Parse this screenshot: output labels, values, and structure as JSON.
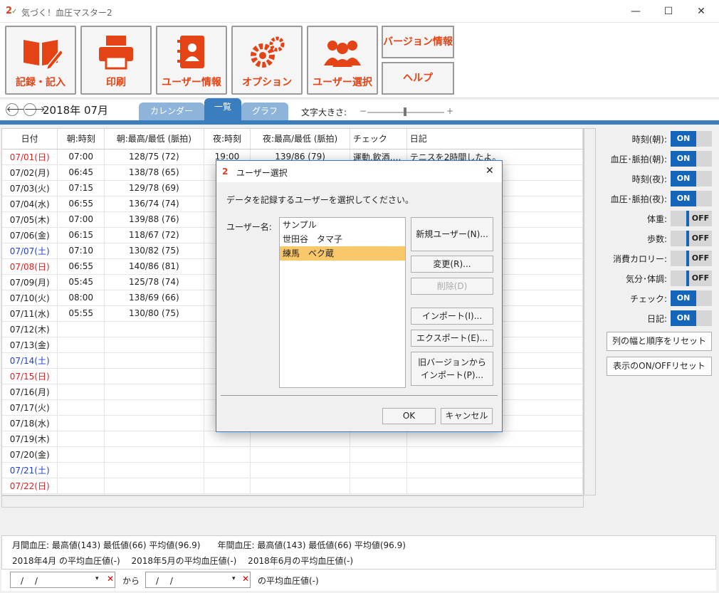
{
  "window": {
    "title": "気づく！血圧マスター2",
    "logo": "2",
    "minimize": "—",
    "maximize": "☐",
    "close": "✕"
  },
  "toolbar": {
    "buttons": [
      {
        "label": "記録・記入",
        "icon": "book-pen-icon"
      },
      {
        "label": "印刷",
        "icon": "printer-icon"
      },
      {
        "label": "ユーザー情報",
        "icon": "address-book-icon"
      },
      {
        "label": "オプション",
        "icon": "gears-icon"
      },
      {
        "label": "ユーザー選択",
        "icon": "users-icon"
      }
    ],
    "version_label": "バージョン情報",
    "help_label": "ヘルプ"
  },
  "nav": {
    "prev": "🡐",
    "next": "🡒",
    "month": "2018年 07月",
    "tabs": [
      "カレンダー",
      "一覧",
      "グラフ"
    ],
    "fontsize_label": "文字大きさ:",
    "minus": "−",
    "plus": "+"
  },
  "grid": {
    "columns": [
      "日付",
      "朝:時刻",
      "朝:最高/最低 (脈拍)",
      "夜:時刻",
      "夜:最高/最低 (脈拍)",
      "チェック",
      "日記"
    ],
    "rows": [
      {
        "d": "07/01(日)",
        "c": "red",
        "mt": "07:00",
        "mb": "128/75 (72)",
        "nt": "19:00",
        "nb": "139/86 (79)",
        "ck": "運動,飲酒,…",
        "dy": "テニスを2時間したよ。"
      },
      {
        "d": "07/02(月)",
        "c": "",
        "mt": "06:45",
        "mb": "138/78 (65)",
        "nt": "",
        "nb": "",
        "ck": "",
        "dy": ""
      },
      {
        "d": "07/03(火)",
        "c": "",
        "mt": "07:15",
        "mb": "129/78 (69)",
        "nt": "",
        "nb": "",
        "ck": "",
        "dy": ""
      },
      {
        "d": "07/04(水)",
        "c": "",
        "mt": "06:55",
        "mb": "136/74 (74)",
        "nt": "",
        "nb": "",
        "ck": "",
        "dy": ""
      },
      {
        "d": "07/05(木)",
        "c": "",
        "mt": "07:00",
        "mb": "139/88 (76)",
        "nt": "",
        "nb": "",
        "ck": "",
        "dy": ""
      },
      {
        "d": "07/06(金)",
        "c": "",
        "mt": "06:15",
        "mb": "118/67 (72)",
        "nt": "",
        "nb": "",
        "ck": "",
        "dy": ""
      },
      {
        "d": "07/07(土)",
        "c": "blue",
        "mt": "07:10",
        "mb": "130/82 (75)",
        "nt": "",
        "nb": "",
        "ck": "",
        "dy": ""
      },
      {
        "d": "07/08(日)",
        "c": "red",
        "mt": "06:55",
        "mb": "140/86 (81)",
        "nt": "",
        "nb": "",
        "ck": "",
        "dy": ""
      },
      {
        "d": "07/09(月)",
        "c": "",
        "mt": "05:45",
        "mb": "125/78 (74)",
        "nt": "",
        "nb": "",
        "ck": "",
        "dy": ""
      },
      {
        "d": "07/10(火)",
        "c": "",
        "mt": "08:00",
        "mb": "138/69 (66)",
        "nt": "",
        "nb": "",
        "ck": "",
        "dy": ""
      },
      {
        "d": "07/11(水)",
        "c": "",
        "mt": "05:55",
        "mb": "130/80 (75)",
        "nt": "",
        "nb": "",
        "ck": "",
        "dy": ""
      },
      {
        "d": "07/12(木)",
        "c": "",
        "mt": "",
        "mb": "",
        "nt": "",
        "nb": "",
        "ck": "",
        "dy": ""
      },
      {
        "d": "07/13(金)",
        "c": "",
        "mt": "",
        "mb": "",
        "nt": "",
        "nb": "",
        "ck": "",
        "dy": ""
      },
      {
        "d": "07/14(土)",
        "c": "blue",
        "mt": "",
        "mb": "",
        "nt": "",
        "nb": "",
        "ck": "",
        "dy": ""
      },
      {
        "d": "07/15(日)",
        "c": "red",
        "mt": "",
        "mb": "",
        "nt": "",
        "nb": "",
        "ck": "",
        "dy": ""
      },
      {
        "d": "07/16(月)",
        "c": "",
        "mt": "",
        "mb": "",
        "nt": "",
        "nb": "",
        "ck": "",
        "dy": ""
      },
      {
        "d": "07/17(火)",
        "c": "",
        "mt": "",
        "mb": "",
        "nt": "",
        "nb": "",
        "ck": "",
        "dy": ""
      },
      {
        "d": "07/18(水)",
        "c": "",
        "mt": "",
        "mb": "",
        "nt": "",
        "nb": "",
        "ck": "",
        "dy": ""
      },
      {
        "d": "07/19(木)",
        "c": "",
        "mt": "",
        "mb": "",
        "nt": "",
        "nb": "",
        "ck": "",
        "dy": ""
      },
      {
        "d": "07/20(金)",
        "c": "",
        "mt": "",
        "mb": "",
        "nt": "",
        "nb": "",
        "ck": "",
        "dy": ""
      },
      {
        "d": "07/21(土)",
        "c": "blue",
        "mt": "",
        "mb": "",
        "nt": "",
        "nb": "",
        "ck": "",
        "dy": ""
      },
      {
        "d": "07/22(日)",
        "c": "red",
        "mt": "",
        "mb": "",
        "nt": "",
        "nb": "",
        "ck": "",
        "dy": ""
      }
    ]
  },
  "settings": {
    "rows": [
      {
        "label": "時刻(朝):",
        "state": "ON"
      },
      {
        "label": "血圧･脈拍(朝):",
        "state": "ON"
      },
      {
        "label": "時刻(夜):",
        "state": "ON"
      },
      {
        "label": "血圧･脈拍(夜):",
        "state": "ON"
      },
      {
        "label": "体重:",
        "state": "OFF"
      },
      {
        "label": "歩数:",
        "state": "OFF"
      },
      {
        "label": "消費カロリー:",
        "state": "OFF"
      },
      {
        "label": "気分･体調:",
        "state": "OFF"
      },
      {
        "label": "チェック:",
        "state": "ON"
      },
      {
        "label": "日記:",
        "state": "ON"
      }
    ],
    "reset_columns": "列の幅と順序をリセット",
    "reset_onoff": "表示のON/OFFリセット"
  },
  "summary": {
    "line1": "月間血圧: 最高値(143) 最低値(66) 平均値(96.9)　　年間血圧: 最高値(143) 最低値(66) 平均値(96.9)",
    "line2": "2018年4月 の平均血圧値(-)　 2018年5月の平均血圧値(-)　 2018年6月の平均血圧値(-)"
  },
  "filter": {
    "date_from": "/　 /",
    "date_to": "/　 /",
    "from_label": "から",
    "avg_label": "の平均血圧値(-)"
  },
  "dialog": {
    "title": "ユーザー選択",
    "message": "データを記録するユーザーを選択してください。",
    "user_label": "ユーザー名:",
    "users": [
      "サンプル",
      "世田谷　タマ子",
      "練馬　ベク蔵"
    ],
    "selected_index": 2,
    "buttons": {
      "new": "新規ユーザー(N)...",
      "change": "変更(R)...",
      "delete": "削除(D)",
      "import": "インポート(I)...",
      "export": "エクスポート(E)...",
      "legacy_1": "旧バージョンから",
      "legacy_2": "インポート(P)...",
      "ok": "OK",
      "cancel": "キャンセル"
    }
  },
  "colors": {
    "accent": "#e44315",
    "tab_blue": "#3a7ec0",
    "toggle_on": "#1565b8",
    "selected_row": "#f9c86a",
    "sunday": "#e02020",
    "saturday": "#2040d0"
  }
}
